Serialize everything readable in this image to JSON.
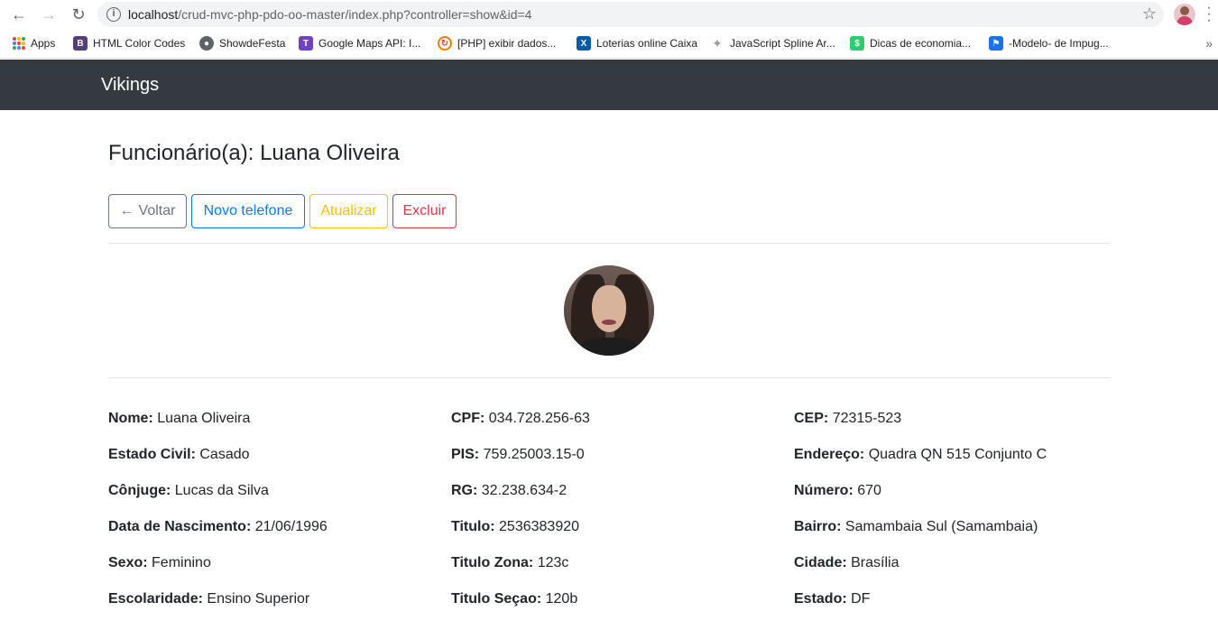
{
  "browser": {
    "url_host": "localhost",
    "url_path": "/crud-mvc-php-pdo-oo-master/index.php?controller=show&id=4",
    "bookmarks": [
      {
        "label": "Apps",
        "icon": "apps-grid-icon"
      },
      {
        "label": "HTML Color Codes",
        "icon": "bootstrap-b-icon",
        "color": "#563d7c"
      },
      {
        "label": "ShowdeFesta",
        "icon": "globe-icon",
        "color": "#5f6368"
      },
      {
        "label": "Google Maps API: I...",
        "icon": "t-icon",
        "color": "#6f42c1"
      },
      {
        "label": "[PHP] exibir dados...",
        "icon": "swirl-icon",
        "color": "#f57c00"
      },
      {
        "label": "Loterias online Caixa",
        "icon": "caixa-x-icon",
        "color": "#005ca9"
      },
      {
        "label": "JavaScript Spline Ar...",
        "icon": "sparkle-icon",
        "color": "#9e9e9e"
      },
      {
        "label": "Dicas de economia...",
        "icon": "dollar-icon",
        "color": "#2ecc71"
      },
      {
        "label": "-Modelo- de Impug...",
        "icon": "flag-icon",
        "color": "#1a73e8"
      }
    ]
  },
  "navbar": {
    "brand": "Vikings"
  },
  "page": {
    "title": "Funcionário(a): Luana Oliveira",
    "buttons": {
      "back": "Voltar",
      "new_phone": "Novo telefone",
      "update": "Atualizar",
      "delete": "Excluir"
    }
  },
  "fields": {
    "col1": [
      {
        "label": "Nome:",
        "value": "Luana Oliveira"
      },
      {
        "label": "Estado Civil:",
        "value": "Casado"
      },
      {
        "label": "Cônjuge:",
        "value": "Lucas da Silva"
      },
      {
        "label": "Data de Nascimento:",
        "value": "21/06/1996"
      },
      {
        "label": "Sexo:",
        "value": "Feminino"
      },
      {
        "label": "Escolaridade:",
        "value": "Ensino Superior"
      }
    ],
    "col2": [
      {
        "label": "CPF:",
        "value": "034.728.256-63"
      },
      {
        "label": "PIS:",
        "value": "759.25003.15-0"
      },
      {
        "label": "RG:",
        "value": "32.238.634-2"
      },
      {
        "label": "Titulo:",
        "value": "2536383920"
      },
      {
        "label": "Titulo Zona:",
        "value": "123c"
      },
      {
        "label": "Titulo Seçao:",
        "value": "120b"
      }
    ],
    "col3": [
      {
        "label": "CEP:",
        "value": "72315-523"
      },
      {
        "label": "Endereço:",
        "value": "Quadra QN 515 Conjunto C"
      },
      {
        "label": "Número:",
        "value": "670"
      },
      {
        "label": "Bairro:",
        "value": "Samambaia Sul (Samambaia)"
      },
      {
        "label": "Cidade:",
        "value": "Brasília"
      },
      {
        "label": "Estado:",
        "value": "DF"
      }
    ]
  }
}
